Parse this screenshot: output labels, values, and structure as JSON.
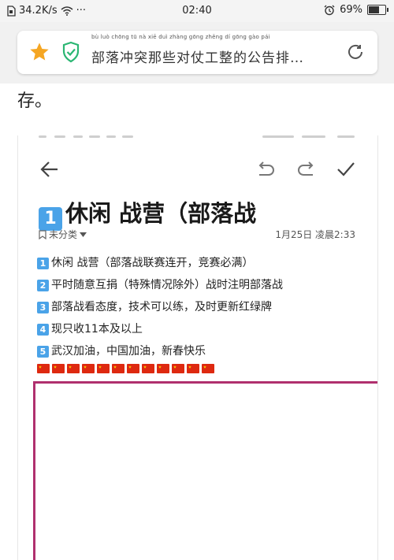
{
  "status_bar": {
    "speed": "34.2K/s",
    "dots": "···",
    "time": "02:40",
    "battery": "69%",
    "battery_level": 0.69
  },
  "url_bar": {
    "title": "部落冲突那些对仗工整的公告排…",
    "pinyin": "bù  luò  chōng  tū   nà   xiē   duì  zhàng gōng zhěng  dí   gōng  gào  pái"
  },
  "article": {
    "continuation": "存。"
  },
  "note": {
    "title_keycap": "1",
    "title": "休闲 战营（部落战",
    "category": "未分类",
    "date": "1月25日 凌晨2:33",
    "lines": [
      {
        "keycap": "1",
        "text": "休闲 战营（部落战联赛连开，竞赛必满）"
      },
      {
        "keycap": "2",
        "text": "平时随意互捐（特殊情况除外）战时注明部落战"
      },
      {
        "keycap": "3",
        "text": "部落战看态度，技术可以练，及时更新红绿牌"
      },
      {
        "keycap": "4",
        "text": "现只收11本及以上"
      },
      {
        "keycap": "5",
        "text": "武汉加油，中国加油，新春快乐"
      }
    ],
    "flag_count": 12
  },
  "colors": {
    "keycap_blue": "#4aa3e8",
    "border_magenta": "#b0306e",
    "star_orange": "#f5a623",
    "shield_green": "#2bb673"
  }
}
